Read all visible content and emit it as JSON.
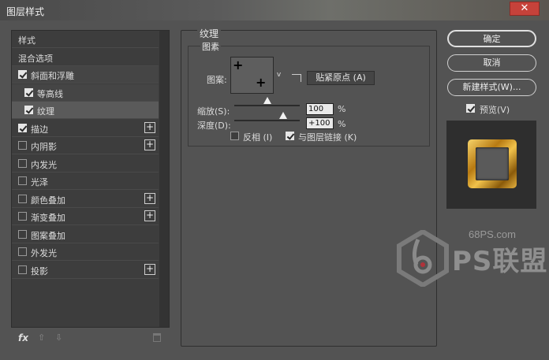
{
  "window": {
    "title": "图层样式",
    "close_glyph": "✕"
  },
  "left_panel": {
    "items": [
      {
        "label": "样式",
        "checkbox": null,
        "plus": false,
        "state": ""
      },
      {
        "label": "混合选项",
        "checkbox": null,
        "plus": false,
        "state": ""
      },
      {
        "label": "斜面和浮雕",
        "checkbox": true,
        "plus": false,
        "state": "on"
      },
      {
        "label": "等高线",
        "checkbox": true,
        "plus": false,
        "state": "on",
        "indent": true
      },
      {
        "label": "纹理",
        "checkbox": true,
        "plus": false,
        "state": "sel",
        "indent": true
      },
      {
        "label": "描边",
        "checkbox": true,
        "plus": true,
        "state": ""
      },
      {
        "label": "内阴影",
        "checkbox": false,
        "plus": true,
        "state": ""
      },
      {
        "label": "内发光",
        "checkbox": false,
        "plus": false,
        "state": ""
      },
      {
        "label": "光泽",
        "checkbox": false,
        "plus": false,
        "state": ""
      },
      {
        "label": "颜色叠加",
        "checkbox": false,
        "plus": true,
        "state": ""
      },
      {
        "label": "渐变叠加",
        "checkbox": false,
        "plus": true,
        "state": ""
      },
      {
        "label": "图案叠加",
        "checkbox": false,
        "plus": false,
        "state": ""
      },
      {
        "label": "外发光",
        "checkbox": false,
        "plus": false,
        "state": ""
      },
      {
        "label": "投影",
        "checkbox": false,
        "plus": true,
        "state": ""
      }
    ],
    "plus_glyph": "+",
    "footer": {
      "fx": "fx",
      "up": "⇧",
      "down": "⇩"
    }
  },
  "texture": {
    "group_title": "纹理",
    "sub_title": "图素",
    "pattern_label": "图案:",
    "snap_button": "贴紧原点 (A)",
    "scale_label": "缩放(S):",
    "scale_value": "100",
    "scale_unit": "%",
    "scale_fraction": 0.5,
    "depth_label": "深度(D):",
    "depth_value": "+100",
    "depth_unit": "%",
    "depth_fraction": 0.75,
    "invert_label": "反相 (I)",
    "invert_checked": false,
    "link_label": "与图层链接 (K)",
    "link_checked": true
  },
  "right": {
    "ok": "确定",
    "cancel": "取消",
    "new_style": "新建样式(W)...",
    "preview_label": "预览(V)",
    "preview_checked": true
  },
  "watermark": {
    "site": "68PS.com",
    "brand": "PS联盟"
  }
}
